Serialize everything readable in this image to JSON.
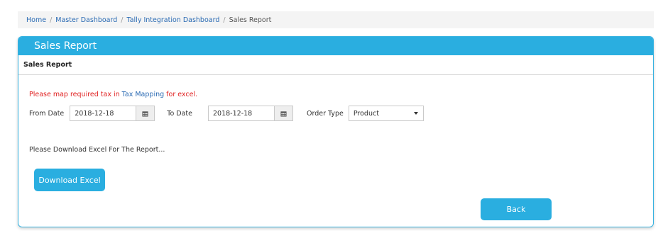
{
  "breadcrumb": {
    "items": [
      "Home",
      "Master Dashboard",
      "Tally Integration Dashboard"
    ],
    "current": "Sales Report",
    "separator": "/"
  },
  "panel": {
    "title": "Sales Report",
    "subtitle": "Sales Report"
  },
  "warning": {
    "prefix": "Please map required tax in ",
    "link": "Tax Mapping",
    "suffix": " for excel."
  },
  "filters": {
    "from_label": "From Date",
    "from_value": "2018-12-18",
    "to_label": "To Date",
    "to_value": "2018-12-18",
    "order_type_label": "Order Type",
    "order_type_value": "Product"
  },
  "info_text": "Please Download Excel For The Report...",
  "buttons": {
    "download": "Download Excel",
    "back": "Back"
  },
  "colors": {
    "accent": "#2aaee0",
    "warning": "#e02020",
    "link": "#2a6ab3"
  }
}
